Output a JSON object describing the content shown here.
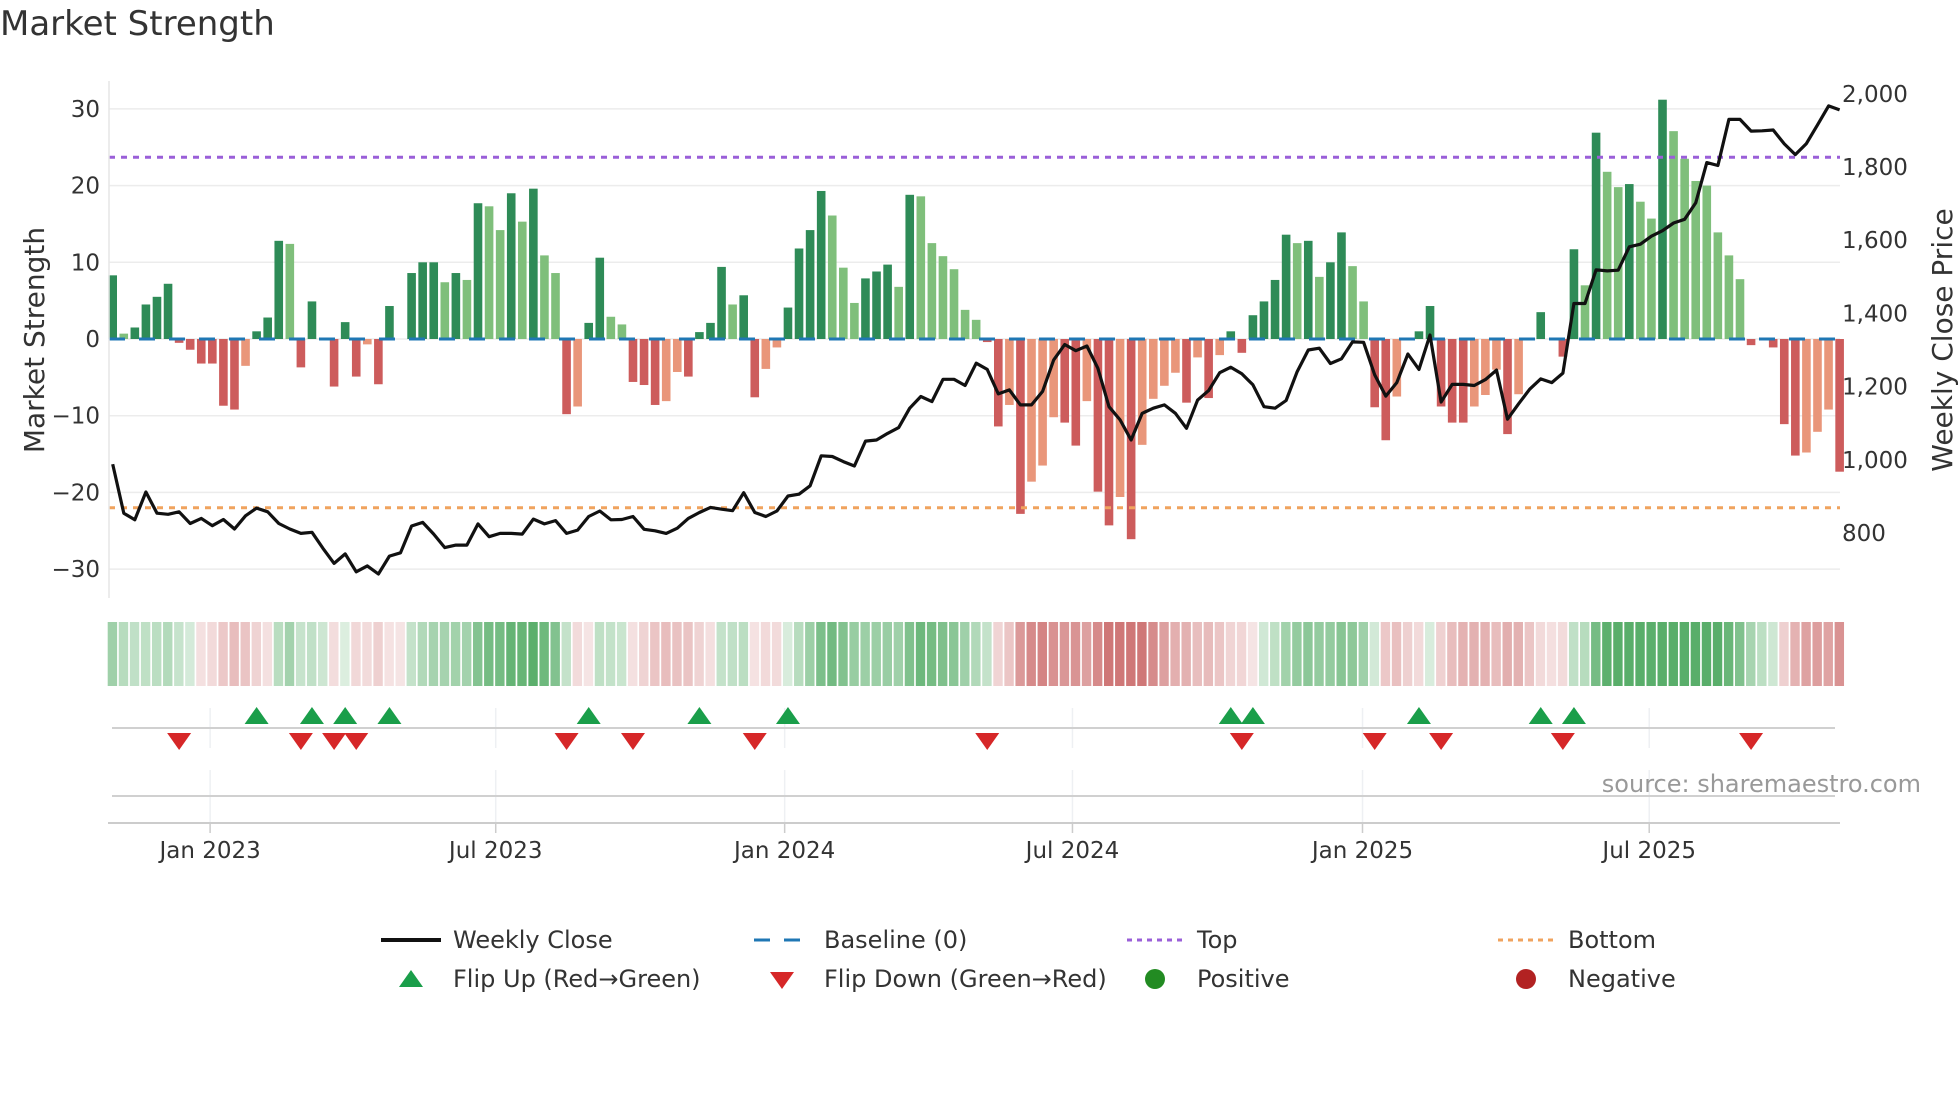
{
  "title": "Market Strength",
  "source": "source: sharemaestro.com",
  "colors": {
    "strong_up": "#2e8b57",
    "weak_up": "#7fbf7b",
    "strong_down": "#cd5c5c",
    "weak_down": "#e9967a",
    "baseline": "#1f77b4",
    "top": "#9a5fd8",
    "bottom": "#f0a35e",
    "close": "#111111",
    "flip_up": "#1a9e4a",
    "flip_down": "#d62728",
    "positive": "#228b22",
    "negative": "#b22222"
  },
  "legend": {
    "weekly_close": "Weekly Close",
    "baseline": "Baseline (0)",
    "top": "Top",
    "bottom": "Bottom",
    "flip_up": "Flip Up (Red→Green)",
    "flip_down": "Flip Down (Green→Red)",
    "positive": "Positive",
    "negative": "Negative"
  },
  "chart_data": {
    "type": "bar",
    "title": "Market Strength",
    "ylabel": "Market Strength",
    "y2label": "Weekly Close Price",
    "ylim": [
      -35,
      34
    ],
    "yticks": [
      30,
      20,
      10,
      0,
      -10,
      -20,
      -30
    ],
    "y2ticks": [
      {
        "v": 2000,
        "label": "2,000"
      },
      {
        "v": 1800,
        "label": "1,800"
      },
      {
        "v": 1600,
        "label": "1,600"
      },
      {
        "v": 1400,
        "label": "1,400"
      },
      {
        "v": 1200,
        "label": "1,200"
      },
      {
        "v": 1000,
        "label": "1,000"
      },
      {
        "v": 800,
        "label": "800"
      }
    ],
    "top_level": 23.7,
    "bottom_level": -22,
    "baseline": 0,
    "xticks": [
      {
        "week": 8.8,
        "label": "Jan 2023"
      },
      {
        "week": 34.6,
        "label": "Jul 2023"
      },
      {
        "week": 60.7,
        "label": "Jan 2024"
      },
      {
        "week": 86.7,
        "label": "Jul 2024"
      },
      {
        "week": 112.9,
        "label": "Jan 2025"
      },
      {
        "week": 138.8,
        "label": "Jul 2025"
      }
    ],
    "strength": [
      8.3,
      0.7,
      1.5,
      4.5,
      5.5,
      7.2,
      -0.5,
      -1.4,
      -3.2,
      -3.2,
      -8.7,
      -9.2,
      -3.5,
      1.0,
      2.8,
      12.8,
      12.4,
      -3.7,
      4.9,
      0,
      -6.2,
      2.2,
      -4.9,
      -0.7,
      -5.9,
      4.3,
      0,
      8.6,
      10,
      10,
      7.4,
      8.6,
      7.7,
      17.7,
      17.3,
      14.2,
      19,
      15.3,
      19.6,
      10.9,
      8.6,
      -9.8,
      -8.8,
      2.1,
      10.6,
      2.9,
      1.9,
      -5.6,
      -6.0,
      -8.6,
      -8.1,
      -4.3,
      -4.9,
      0.9,
      2.1,
      9.4,
      4.5,
      5.7,
      -7.6,
      -3.9,
      -1.1,
      4.1,
      11.8,
      14.2,
      19.3,
      16.1,
      9.3,
      4.7,
      7.9,
      8.8,
      9.7,
      6.8,
      18.8,
      18.6,
      12.5,
      10.8,
      9.1,
      3.8,
      2.5,
      -0.4,
      -11.4,
      -8.6,
      -22.8,
      -18.6,
      -16.5,
      -10.2,
      -10.9,
      -13.9,
      -8.1,
      -19.9,
      -24.3,
      -20.6,
      -26.1,
      -13.8,
      -7.8,
      -6.1,
      -4.4,
      -8.3,
      -2.4,
      -7.7,
      -2.1,
      1.0,
      -1.8,
      3.1,
      4.9,
      7.7,
      13.6,
      12.5,
      12.8,
      8.1,
      10.0,
      13.9,
      9.5,
      4.9,
      -8.9,
      -13.2,
      -7.5,
      0,
      1.0,
      4.3,
      -8.8,
      -10.9,
      -10.9,
      -8.8,
      -7.3,
      -4.0,
      -12.4,
      -7.2,
      0,
      3.5,
      0,
      -2.3,
      11.7,
      7.0,
      26.9,
      21.8,
      19.8,
      20.2,
      17.9,
      15.7,
      31.2,
      27.1,
      23.5,
      20.6,
      20.0,
      13.9,
      10.9,
      7.8,
      -0.8,
      0,
      -1.1,
      -11.1,
      -15.2,
      -14.8,
      -12.1,
      -9.2,
      -17.3
    ],
    "weekly_close": [
      988,
      854,
      836,
      912,
      854,
      851,
      858,
      826,
      840,
      820,
      837,
      811,
      847,
      868,
      858,
      826,
      811,
      799,
      802,
      758,
      717,
      743,
      694,
      710,
      688,
      737,
      746,
      819,
      829,
      797,
      760,
      767,
      767,
      825,
      790,
      799,
      799,
      797,
      838,
      825,
      834,
      799,
      808,
      845,
      860,
      836,
      837,
      845,
      810,
      806,
      799,
      813,
      840,
      856,
      870,
      865,
      861,
      910,
      856,
      845,
      860,
      901,
      906,
      929,
      1011,
      1009,
      995,
      983,
      1051,
      1054,
      1072,
      1088,
      1141,
      1173,
      1159,
      1220,
      1220,
      1203,
      1264,
      1247,
      1180,
      1191,
      1150,
      1150,
      1187,
      1273,
      1315,
      1298,
      1311,
      1250,
      1145,
      1109,
      1054,
      1127,
      1141,
      1150,
      1127,
      1086,
      1163,
      1189,
      1238,
      1253,
      1235,
      1205,
      1145,
      1141,
      1162,
      1241,
      1300,
      1305,
      1263,
      1276,
      1322,
      1321,
      1232,
      1174,
      1211,
      1289,
      1247,
      1341,
      1158,
      1206,
      1206,
      1203,
      1219,
      1245,
      1111,
      1153,
      1193,
      1221,
      1211,
      1237,
      1427,
      1427,
      1519,
      1516,
      1518,
      1582,
      1589,
      1611,
      1626,
      1647,
      1657,
      1702,
      1812,
      1804,
      1930,
      1930,
      1898,
      1899,
      1901,
      1863,
      1834,
      1864,
      1915,
      1967,
      1956
    ],
    "flip_up_weeks": [
      13,
      18,
      21,
      25,
      43,
      53,
      61,
      101,
      103,
      118,
      129,
      132
    ],
    "flip_down_weeks": [
      6,
      17,
      20,
      22,
      41,
      47,
      58,
      79,
      102,
      114,
      120,
      131,
      148
    ]
  }
}
